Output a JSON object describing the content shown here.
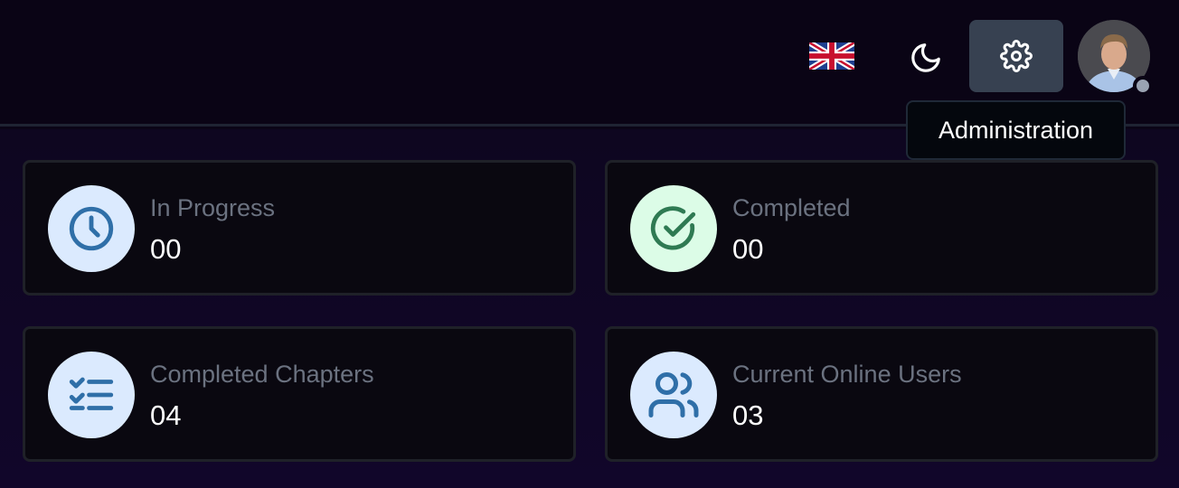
{
  "header": {
    "language_icon": "uk-flag-icon",
    "theme_icon": "moon-icon",
    "settings_icon": "gear-icon",
    "avatar_icon": "user-avatar",
    "tooltip": "Administration",
    "colors": {
      "settings_bg": "#374151",
      "status_dot": "#9aa3b2"
    }
  },
  "stats": [
    {
      "label": "In Progress",
      "value": "00",
      "icon": "clock-icon",
      "icon_color": "#2f6fa8",
      "icon_bg": "#dbeafe"
    },
    {
      "label": "Completed",
      "value": "00",
      "icon": "check-circle-icon",
      "icon_color": "#2f7a53",
      "icon_bg": "#dcfce7"
    },
    {
      "label": "Completed Chapters",
      "value": "04",
      "icon": "checklist-icon",
      "icon_color": "#2f6fa8",
      "icon_bg": "#dbeafe"
    },
    {
      "label": "Current Online Users",
      "value": "03",
      "icon": "users-icon",
      "icon_color": "#2f6fa8",
      "icon_bg": "#dbeafe"
    }
  ]
}
